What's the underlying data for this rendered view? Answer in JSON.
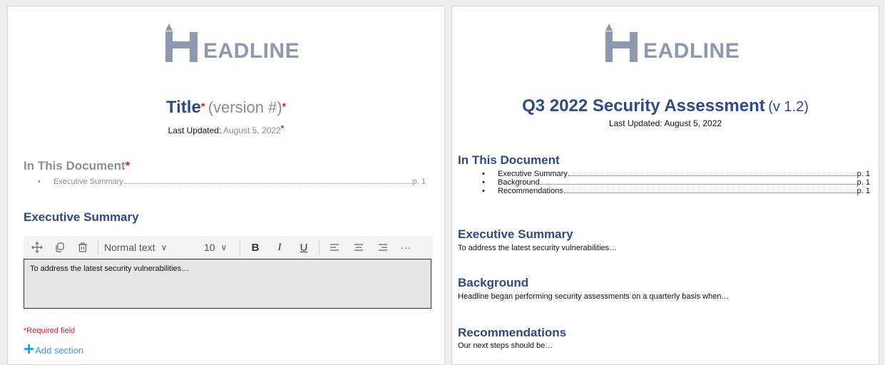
{
  "colors": {
    "heading_blue": "#2c4a8c",
    "required_red": "#e0202e",
    "placeholder_grey": "#8c8c8c",
    "logo_grey": "#8d99ae",
    "link_blue": "#29a3dd"
  },
  "left": {
    "logo": {
      "letters": "EADLINE",
      "icon": "pencil-h-logo-icon"
    },
    "title": {
      "main": "Title",
      "version": "(version #)",
      "required_mark": "*"
    },
    "last_updated": {
      "label": "Last Updated:",
      "value": "August 5, 2022",
      "required_mark": "*"
    },
    "toc": {
      "heading": "In This Document",
      "required_mark": "*",
      "items": [
        {
          "label": "Executive Summary",
          "page": "p. 1"
        }
      ]
    },
    "exec_summary": {
      "heading": "Executive Summary"
    },
    "toolbar": {
      "text_style": "Normal text",
      "font_size": "10",
      "bold": "B",
      "italic": "I",
      "underline": "U",
      "more": "···"
    },
    "editor": {
      "value": "To address the latest security vulnerabilities…"
    },
    "required_note": "*Required field",
    "add_section": {
      "plus": "+",
      "label": "Add section"
    }
  },
  "right": {
    "logo": {
      "letters": "EADLINE",
      "icon": "pencil-h-logo-icon"
    },
    "title": {
      "main": "Q3 2022 Security Assessment",
      "version": "(v 1.2)"
    },
    "last_updated": "Last Updated: August 5, 2022",
    "toc": {
      "heading": "In This Document",
      "items": [
        {
          "label": "Executive Summary",
          "page": "p. 1"
        },
        {
          "label": "Background",
          "page": "p. 1"
        },
        {
          "label": "Recommendations",
          "page": "p. 1"
        }
      ]
    },
    "sections": [
      {
        "heading": "Executive Summary",
        "text": "To address the latest security vulnerabilities…"
      },
      {
        "heading": "Background",
        "text": "Headline began performing security assessments on a quarterly basis when…"
      },
      {
        "heading": "Recommendations",
        "text": "Our next steps should be…"
      }
    ]
  }
}
